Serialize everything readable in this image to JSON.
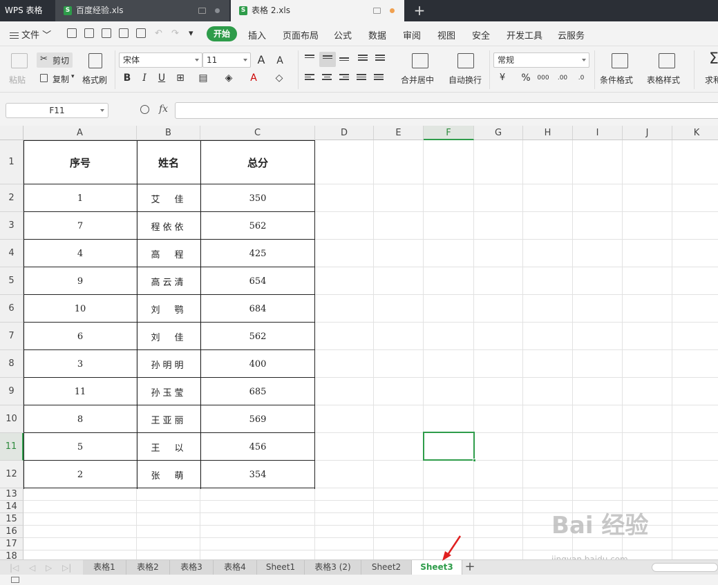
{
  "app": {
    "name": "WPS 表格"
  },
  "tabs": [
    {
      "label": "百度经验.xls",
      "active": false
    },
    {
      "label": "表格 2.xls",
      "active": true
    }
  ],
  "menu": {
    "file": "文件",
    "items": [
      "开始",
      "插入",
      "页面布局",
      "公式",
      "数据",
      "审阅",
      "视图",
      "安全",
      "开发工具",
      "云服务"
    ]
  },
  "ribbon": {
    "paste": "粘贴",
    "cut": "剪切",
    "copy": "复制",
    "format_painter": "格式刷",
    "font_name": "宋体",
    "font_size": "11",
    "merge_center": "合并居中",
    "wrap_text": "自动换行",
    "number_format": "常规",
    "conditional_format": "条件格式",
    "table_style": "表格样式",
    "sum": "求和"
  },
  "formula_bar": {
    "name_box": "F11",
    "fx": "fx",
    "value": ""
  },
  "columns": [
    "A",
    "B",
    "C",
    "D",
    "E",
    "F",
    "G",
    "H",
    "I",
    "J",
    "K"
  ],
  "rows": [
    "1",
    "2",
    "3",
    "4",
    "5",
    "6",
    "7",
    "8",
    "9",
    "10",
    "11",
    "12",
    "13",
    "14",
    "15",
    "16",
    "17",
    "18"
  ],
  "selected_cell": {
    "column": "F",
    "row": "11"
  },
  "table": {
    "headers": [
      "序号",
      "姓名",
      "总分"
    ],
    "rows": [
      [
        "1",
        "艾　佳",
        "350"
      ],
      [
        "7",
        "程依依",
        "562"
      ],
      [
        "4",
        "高　程",
        "425"
      ],
      [
        "9",
        "高云清",
        "654"
      ],
      [
        "10",
        "刘　鹗",
        "684"
      ],
      [
        "6",
        "刘　佳",
        "562"
      ],
      [
        "3",
        "孙明明",
        "400"
      ],
      [
        "11",
        "孙玉莹",
        "685"
      ],
      [
        "8",
        "王亚丽",
        "569"
      ],
      [
        "5",
        "王　以",
        "456"
      ],
      [
        "2",
        "张　萌",
        "354"
      ]
    ]
  },
  "sheets": [
    "表格1",
    "表格2",
    "表格3",
    "表格4",
    "Sheet1",
    "表格3 (2)",
    "Sheet2",
    "Sheet3"
  ],
  "active_sheet": "Sheet3",
  "watermark": {
    "main": "Bai 经验",
    "sub": "jingyan.baidu.com"
  },
  "colors": {
    "accent": "#2e9c4a",
    "arrow": "#e02020",
    "titlebar": "#2b2f36"
  }
}
